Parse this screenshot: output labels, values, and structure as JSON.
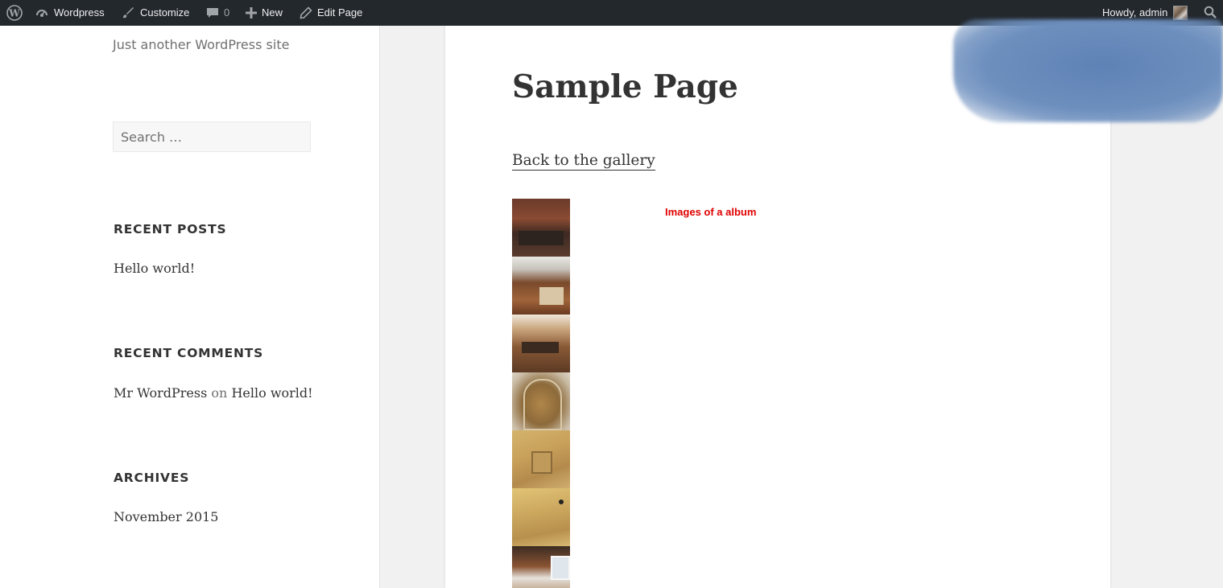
{
  "adminbar": {
    "wp_logo_icon": "wordpress-logo-icon",
    "site_name": "Wordpress",
    "customize": "Customize",
    "comments_count": "0",
    "new": "New",
    "edit_page": "Edit Page",
    "howdy": "Howdy, admin",
    "search_icon": "search-icon"
  },
  "sidebar": {
    "site_description": "Just another WordPress site",
    "search_placeholder": "Search …",
    "recent_posts_title": "RECENT POSTS",
    "recent_posts": [
      "Hello world!"
    ],
    "recent_comments_title": "RECENT COMMENTS",
    "recent_comment": {
      "author": "Mr WordPress",
      "on": "on",
      "post": "Hello world!"
    },
    "archives_title": "ARCHIVES",
    "archives": [
      "November 2015"
    ]
  },
  "content": {
    "title": "Sample Page",
    "back_link": "Back to the gallery",
    "album_label": "Images of a album",
    "thumbnail_count": 7
  },
  "colors": {
    "adminbar_bg": "#23282d",
    "album_label": "#e00000",
    "page_bg": "#f1f1f1"
  }
}
